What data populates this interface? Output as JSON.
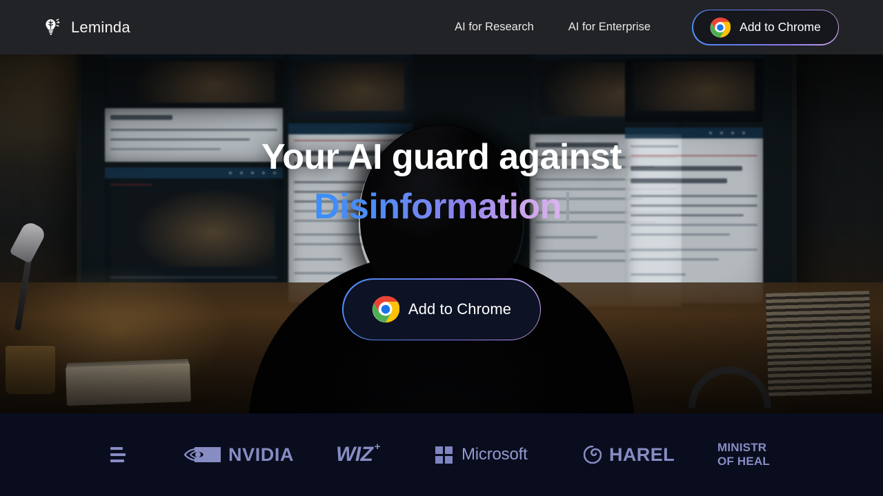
{
  "header": {
    "brand_name": "Leminda",
    "brand_icon": "lightbulb-brain-icon",
    "nav": [
      {
        "label": "AI for Research"
      },
      {
        "label": "AI for Enterprise"
      }
    ],
    "cta": {
      "label": "Add to Chrome",
      "icon": "chrome-icon"
    },
    "background_color": "#222326"
  },
  "hero": {
    "headline_line1": "Your AI guard against",
    "headline_line2": "Disinformation",
    "typing_caret": "|",
    "gradient_start": "#3b8ef8",
    "gradient_end": "#dbb3ef",
    "cta": {
      "label": "Add to Chrome",
      "icon": "chrome-icon"
    },
    "background_description": "hooded person at desk facing monitors with blurred news articles"
  },
  "logo_band": {
    "background_color": "#090d1e",
    "logo_color": "#878cc3",
    "items": [
      {
        "name": "partial-logo",
        "label": ""
      },
      {
        "name": "nvidia",
        "label": "NVIDIA"
      },
      {
        "name": "wiz",
        "label": "WIZ",
        "superscript": "+"
      },
      {
        "name": "microsoft",
        "label": "Microsoft"
      },
      {
        "name": "harel",
        "label": "HAREL"
      },
      {
        "name": "ministry-of-health",
        "label_line1": "MINISTR",
        "label_line2": "OF HEAL"
      }
    ]
  }
}
